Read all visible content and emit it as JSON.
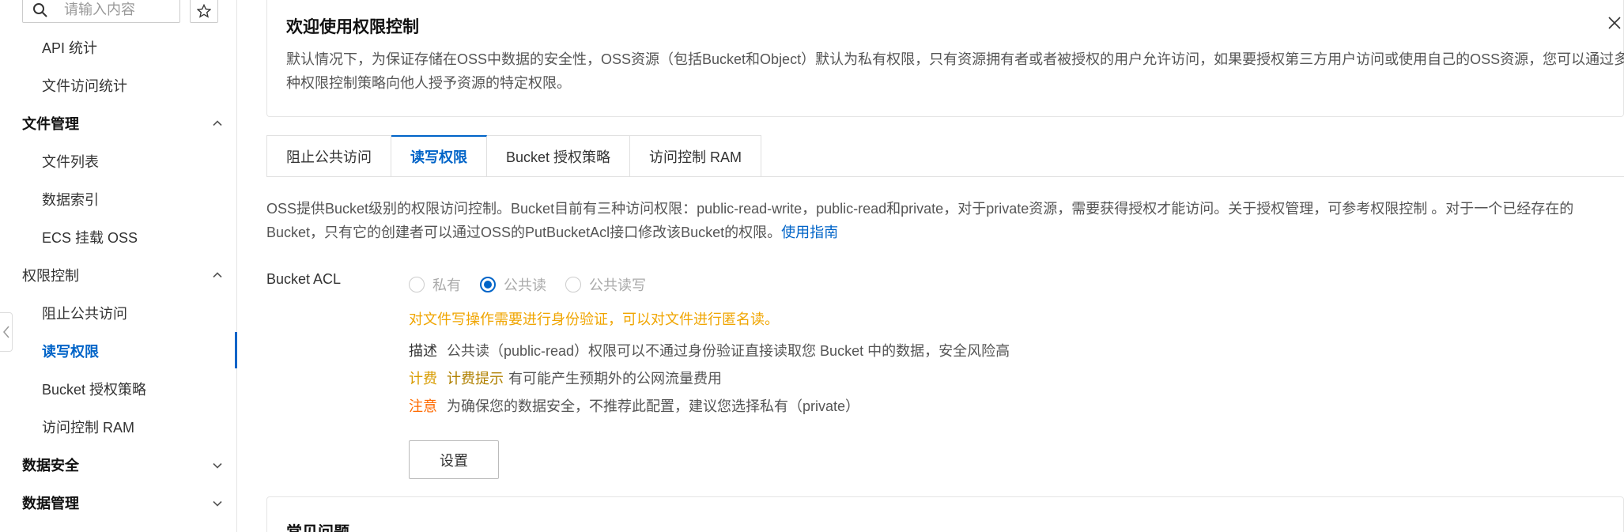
{
  "sidebar": {
    "search_placeholder": "请输入内容",
    "items": {
      "api_stats": "API 统计",
      "file_access_stats": "文件访问统计",
      "file_mgmt": "文件管理",
      "file_list": "文件列表",
      "data_index": "数据索引",
      "ecs_mount": "ECS 挂载 OSS",
      "perm_control": "权限控制",
      "block_public": "阻止公共访问",
      "rw_perm": "读写权限",
      "bucket_policy": "Bucket 授权策略",
      "ram": "访问控制 RAM",
      "data_security": "数据安全",
      "data_mgmt": "数据管理"
    }
  },
  "welcome": {
    "title": "欢迎使用权限控制",
    "text": "默认情况下，为保证存储在OSS中数据的安全性，OSS资源（包括Bucket和Object）默认为私有权限，只有资源拥有者或者被授权的用户允许访问，如果要授权第三方用户访问或使用自己的OSS资源，您可以通过多种权限控制策略向他人授予资源的特定权限。"
  },
  "tabs": [
    "阻止公共访问",
    "读写权限",
    "Bucket 授权策略",
    "访问控制 RAM"
  ],
  "desc": {
    "text": "OSS提供Bucket级别的权限访问控制。Bucket目前有三种访问权限：public-read-write，public-read和private，对于private资源，需要获得授权才能访问。关于授权管理，可参考权限控制 。对于一个已经存在的Bucket，只有它的创建者可以通过OSS的PutBucketAcl接口修改该Bucket的权限。",
    "link": "使用指南"
  },
  "acl": {
    "label": "Bucket ACL",
    "options": [
      "私有",
      "公共读",
      "公共读写"
    ],
    "selected": "公共读",
    "warning": "对文件写操作需要进行身份验证，可以对文件进行匿名读。",
    "desc_label": "描述",
    "desc_text": "公共读（public-read）权限可以不通过身份验证直接读取您 Bucket 中的数据，安全风险高",
    "fee_label": "计费",
    "fee_link": "计费提示",
    "fee_text": "有可能产生预期外的公网流量费用",
    "note_label": "注意",
    "note_text": "为确保您的数据安全，不推荐此配置，建议您选择私有（private）",
    "set_button": "设置"
  },
  "faq": {
    "title": "常见问题"
  },
  "colors": {
    "accent": "#0064c8",
    "warning": "#f0a500",
    "note": "#ff6a00"
  }
}
